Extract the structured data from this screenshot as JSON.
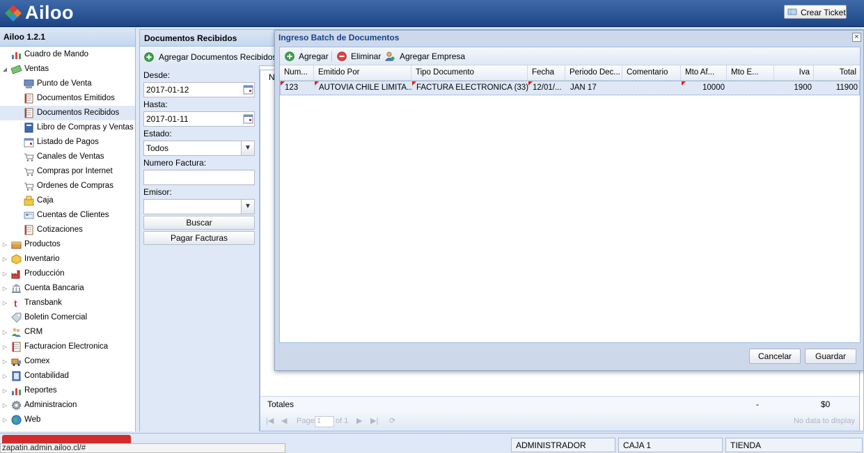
{
  "app": {
    "logo_text": "Ailoo",
    "crear_ticket_label": "Crear Ticket"
  },
  "sidebar": {
    "title": "Ailoo 1.2.1",
    "items": [
      {
        "label": "Cuadro de Mando",
        "icon": "chart-icon",
        "level": 0,
        "arrow": ""
      },
      {
        "label": "Ventas",
        "icon": "money-icon",
        "level": 0,
        "arrow": "expanded"
      },
      {
        "label": "Punto de Venta",
        "icon": "pos-icon",
        "level": 1,
        "arrow": ""
      },
      {
        "label": "Documentos Emitidos",
        "icon": "document-icon",
        "level": 1,
        "arrow": ""
      },
      {
        "label": "Documentos Recibidos",
        "icon": "document-icon",
        "level": 1,
        "arrow": "",
        "selected": true
      },
      {
        "label": "Libro de Compras y Ventas",
        "icon": "book-icon",
        "level": 1,
        "arrow": ""
      },
      {
        "label": "Listado de Pagos",
        "icon": "calendar-icon",
        "level": 1,
        "arrow": ""
      },
      {
        "label": "Canales de Ventas",
        "icon": "cart-icon",
        "level": 1,
        "arrow": ""
      },
      {
        "label": "Compras por Internet",
        "icon": "cart-icon",
        "level": 1,
        "arrow": ""
      },
      {
        "label": "Ordenes de Compras",
        "icon": "cart-icon",
        "level": 1,
        "arrow": ""
      },
      {
        "label": "Caja",
        "icon": "cash-icon",
        "level": 1,
        "arrow": ""
      },
      {
        "label": "Cuentas de Clientes",
        "icon": "card-icon",
        "level": 1,
        "arrow": ""
      },
      {
        "label": "Cotizaciones",
        "icon": "document-icon",
        "level": 1,
        "arrow": ""
      },
      {
        "label": "Productos",
        "icon": "box-icon",
        "level": 0,
        "arrow": "collapsed"
      },
      {
        "label": "Inventario",
        "icon": "package-icon",
        "level": 0,
        "arrow": "collapsed"
      },
      {
        "label": "Producción",
        "icon": "factory-icon",
        "level": 0,
        "arrow": "collapsed"
      },
      {
        "label": "Cuenta Bancaria",
        "icon": "bank-icon",
        "level": 0,
        "arrow": "collapsed"
      },
      {
        "label": "Transbank",
        "icon": "transbank-icon",
        "level": 0,
        "arrow": "collapsed"
      },
      {
        "label": "Boletin Comercial",
        "icon": "tag-icon",
        "level": 0,
        "arrow": ""
      },
      {
        "label": "CRM",
        "icon": "users-icon",
        "level": 0,
        "arrow": "collapsed"
      },
      {
        "label": "Facturacion Electronica",
        "icon": "document-icon",
        "level": 0,
        "arrow": "collapsed"
      },
      {
        "label": "Comex",
        "icon": "truck-icon",
        "level": 0,
        "arrow": "collapsed"
      },
      {
        "label": "Contabilidad",
        "icon": "ledger-icon",
        "level": 0,
        "arrow": "collapsed"
      },
      {
        "label": "Reportes",
        "icon": "chart-icon",
        "level": 0,
        "arrow": "collapsed"
      },
      {
        "label": "Administracion",
        "icon": "gear-icon",
        "level": 0,
        "arrow": "collapsed"
      },
      {
        "label": "Web",
        "icon": "globe-icon",
        "level": 0,
        "arrow": "collapsed"
      }
    ]
  },
  "docs": {
    "title": "Documentos Recibidos",
    "toolbar_add_label": "Agregar Documentos Recibidos",
    "desde_label": "Desde:",
    "desde_value": "2017-01-12",
    "hasta_label": "Hasta:",
    "hasta_value": "2017-01-11",
    "estado_label": "Estado:",
    "estado_value": "Todos",
    "numero_label": "Numero Factura:",
    "numero_value": "",
    "emisor_label": "Emisor:",
    "emisor_value": "",
    "buscar_label": "Buscar",
    "pagar_label": "Pagar Facturas",
    "grid_first_header": "N",
    "totales_label": "Totales",
    "totales_dash": "-",
    "totales_sum": "$0",
    "pager_page_label": "Page",
    "pager_page_value": "1",
    "pager_of_label": "of 1",
    "pager_empty": "No data to display"
  },
  "modal": {
    "title": "Ingreso Batch de Documentos",
    "close_glyph": "×",
    "toolbar": {
      "agregar": "Agregar",
      "eliminar": "Eliminar",
      "agregar_empresa": "Agregar Empresa"
    },
    "columns": [
      "Num...",
      "Emitido Por",
      "Tipo Documento",
      "Fecha",
      "Periodo Dec...",
      "Comentario",
      "Mto Af...",
      "Mto E...",
      "Iva",
      "Total"
    ],
    "row": {
      "num": "123",
      "emitido_por": "AUTOVIA CHILE LIMITA...",
      "tipo_documento": "FACTURA ELECTRONICA (33)",
      "fecha": "12/01/...",
      "periodo": "JAN 17",
      "comentario": "",
      "mto_afecto": "10000",
      "mto_exento": "",
      "iva": "1900",
      "total": "11900"
    },
    "cancel_label": "Cancelar",
    "save_label": "Guardar"
  },
  "statusbar": {
    "user": "ADMINISTRADOR",
    "caja": "CAJA 1",
    "tienda": "TIENDA",
    "url": "zapatin.admin.ailoo.cl/#"
  }
}
